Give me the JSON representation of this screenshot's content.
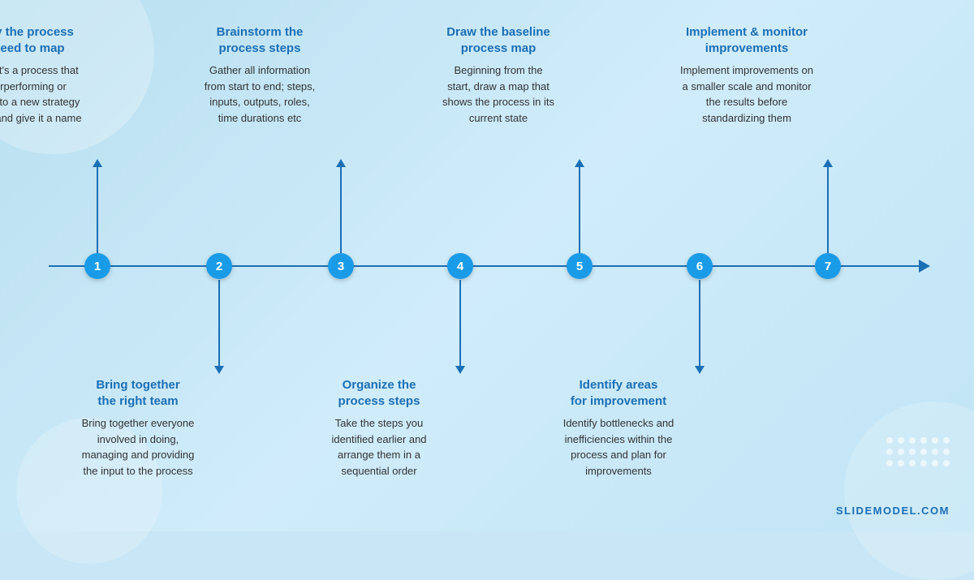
{
  "background_color": "#c8e6f5",
  "accent_color": "#1a9be8",
  "line_color": "#1a6fb5",
  "title_color": "#1a6fb5",
  "steps": [
    {
      "number": "1",
      "title": "Identify the process\nyou need to map",
      "description": "Whether it's a process that\nis underperforming or\nimportant to a new strategy\nidentify it and give it a name",
      "position": "above",
      "left_pct": 120
    },
    {
      "number": "2",
      "title": "Bring together\nthe right team",
      "description": "Bring together everyone\ninvolved in doing,\nmanaging and providing\nthe input to the process",
      "position": "below",
      "left_pct": 270
    },
    {
      "number": "3",
      "title": "Brainstorm the\nprocess steps",
      "description": "Gather all information\nfrom start to end; steps,\ninputs, outputs, roles,\ntime durations etc",
      "position": "above",
      "left_pct": 420
    },
    {
      "number": "4",
      "title": "Organize the\nprocess steps",
      "description": "Take the steps you\nidentified earlier and\narrange them in a\nsequential order",
      "position": "below",
      "left_pct": 567
    },
    {
      "number": "5",
      "title": "Draw the baseline\nprocess map",
      "description": "Beginning from the\nstart, draw a map that\nshows the process in its\ncurrent state",
      "position": "above",
      "left_pct": 714
    },
    {
      "number": "6",
      "title": "Identify areas\nfor improvement",
      "description": "Identify bottlenecks and\ninefficiencies within the\nprocess and plan for\nimprovements",
      "position": "below",
      "left_pct": 862
    },
    {
      "number": "7",
      "title": "Implement & monitor\nimprovements",
      "description": "Implement improvements on\na smaller scale and monitor\nthe results before\nstandardizing them",
      "position": "above",
      "left_pct": 1020
    }
  ],
  "branding": "SLIDEMODEL.COM"
}
